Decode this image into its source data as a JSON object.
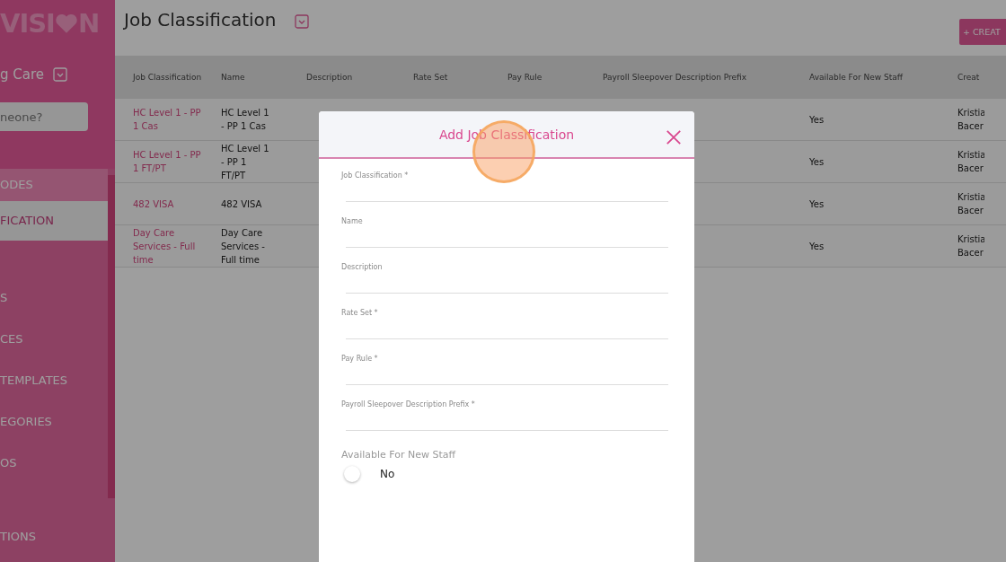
{
  "sidebar": {
    "logo_left": "VISI",
    "logo_right": "N",
    "organisation": "g Care",
    "search": {
      "placeholder": "neone?"
    },
    "items": [
      {
        "label": "ODES",
        "selected": false
      },
      {
        "label": "FICATION",
        "selected": true
      },
      {
        "label": "S",
        "selected": false
      },
      {
        "label": "CES",
        "selected": false
      },
      {
        "label": "TEMPLATES",
        "selected": false
      },
      {
        "label": "EGORIES",
        "selected": false
      },
      {
        "label": "OS",
        "selected": false
      },
      {
        "label": "TIONS",
        "selected": false
      }
    ]
  },
  "page": {
    "title": "Job Classification",
    "create_button": "+ CREAT"
  },
  "table": {
    "columns": [
      "Job Classification",
      "Name",
      "Description",
      "Rate Set",
      "Pay Rule",
      "Payroll Sleepover Description Prefix",
      "Available For New Staff",
      "Creat"
    ],
    "rows": [
      {
        "job_classification": "HC Level 1 - PP 1 Cas",
        "name": "HC Level 1 - PP 1 Cas",
        "available": "Yes",
        "created_by": "Kristia Bacer"
      },
      {
        "job_classification": "HC Level 1 - PP 1 FT/PT",
        "name": "HC Level 1 - PP 1 FT/PT",
        "available": "Yes",
        "created_by": "Kristia Bacer"
      },
      {
        "job_classification": "482 VISA",
        "name": "482 VISA",
        "available": "Yes",
        "created_by": "Kristia Bacer"
      },
      {
        "job_classification": "Day Care Services - Full time",
        "name": "Day Care Services - Full time",
        "available": "Yes",
        "created_by": "Kristia Bacer"
      }
    ]
  },
  "dialog": {
    "title": "Add Job Classification",
    "fields": [
      {
        "label": "Job Classification *"
      },
      {
        "label": "Name"
      },
      {
        "label": "Description"
      },
      {
        "label": "Rate Set *"
      },
      {
        "label": "Pay Rule *"
      },
      {
        "label": "Payroll Sleepover Description Prefix *"
      }
    ],
    "toggle": {
      "label": "Available For New Staff",
      "on": false,
      "state_text": "No"
    }
  }
}
